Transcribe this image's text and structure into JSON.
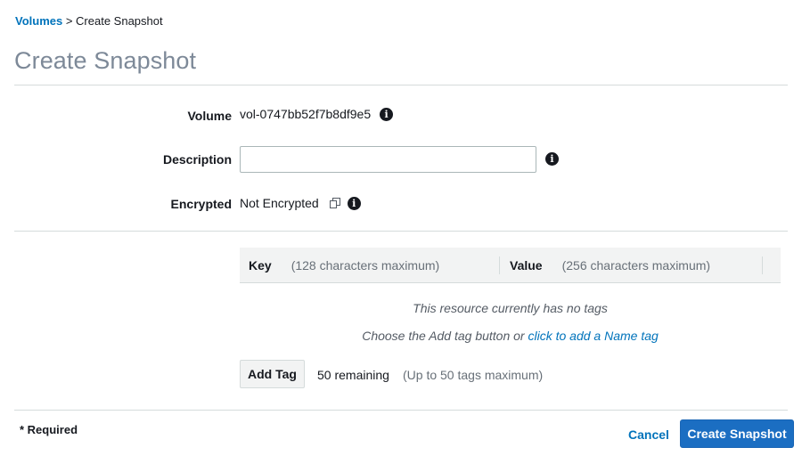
{
  "breadcrumb": {
    "parent": "Volumes",
    "separator": " > ",
    "current": "Create Snapshot"
  },
  "page_title": "Create Snapshot",
  "form": {
    "volume": {
      "label": "Volume",
      "value": "vol-0747bb52f7b8df9e5",
      "info_icon": "info-icon"
    },
    "description": {
      "label": "Description",
      "value": "",
      "placeholder": "",
      "info_icon": "info-icon"
    },
    "encrypted": {
      "label": "Encrypted",
      "value": "Not Encrypted",
      "copy_icon": "copy-icon",
      "info_icon": "info-icon"
    }
  },
  "tags": {
    "key_header": "Key",
    "key_hint": "(128 characters maximum)",
    "value_header": "Value",
    "value_hint": "(256 characters maximum)",
    "empty_message": "This resource currently has no tags",
    "choose_prefix": "Choose the Add tag button or ",
    "name_tag_link": "click to add a Name tag",
    "add_tag_label": "Add Tag",
    "remaining": "50 remaining",
    "max_note": "(Up to 50 tags maximum)"
  },
  "footer": {
    "required_note": "* Required",
    "cancel_label": "Cancel",
    "create_label": "Create Snapshot"
  },
  "colors": {
    "link": "#0073bb",
    "primary_button": "#1b6ec2",
    "title_gray": "#7d8998",
    "header_bg": "#f2f3f3"
  }
}
